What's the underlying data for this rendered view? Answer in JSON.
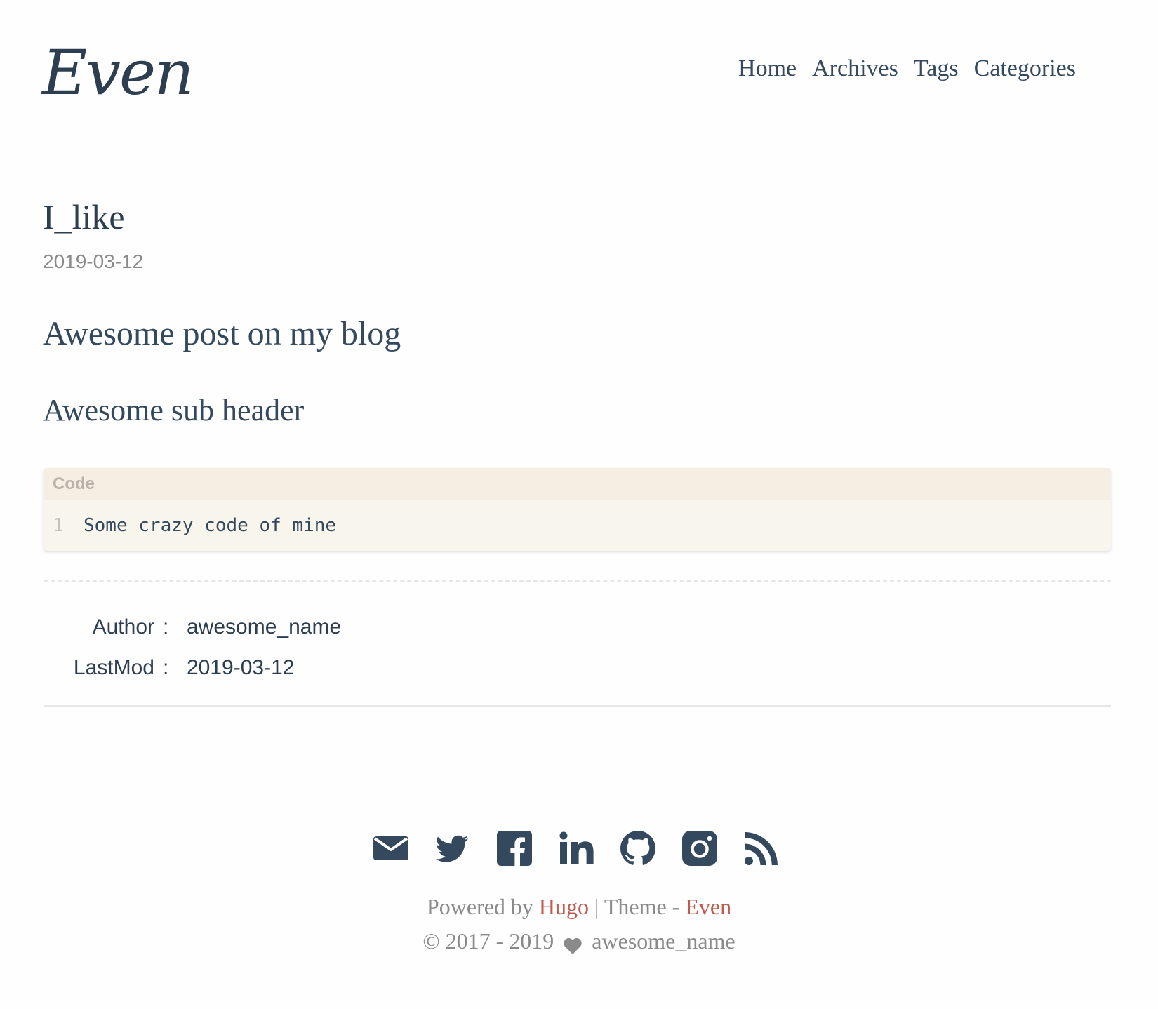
{
  "header": {
    "logo": "Even",
    "nav": [
      "Home",
      "Archives",
      "Tags",
      "Categories"
    ]
  },
  "post": {
    "title": "I_like",
    "date": "2019-03-12",
    "h1": "Awesome post on my blog",
    "h2": "Awesome sub header",
    "code": {
      "title": "Code",
      "line_number": "1",
      "line": "Some crazy code of mine"
    },
    "meta": {
      "author_label": "Author",
      "author": "awesome_name",
      "lastmod_label": "LastMod",
      "lastmod": "2019-03-12",
      "colon": ":"
    }
  },
  "footer": {
    "social_icons": [
      "email-icon",
      "twitter-icon",
      "facebook-icon",
      "linkedin-icon",
      "github-icon",
      "instagram-icon",
      "rss-icon"
    ],
    "powered_by": "Powered by",
    "hugo": "Hugo",
    "theme_separator": "| Theme -",
    "theme": "Even",
    "copyright_years": "© 2017 - 2019",
    "copyright_name": "awesome_name"
  },
  "colors": {
    "text": "#34495e",
    "accent": "#c05b4d",
    "muted": "#8a8a8a",
    "code_bg": "#f8f5ec"
  }
}
